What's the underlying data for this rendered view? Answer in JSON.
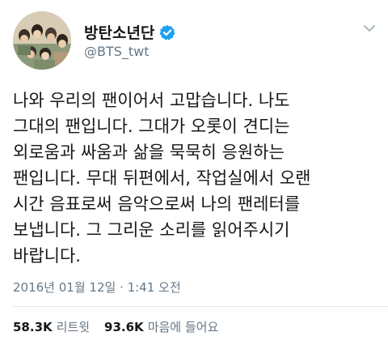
{
  "author": {
    "display_name": "방탄소년단",
    "handle": "@BTS_twt",
    "verified": true
  },
  "tweet": {
    "text": "나와 우리의 팬이어서 고맙습니다. 나도\n그대의 팬입니다. 그대가 오롯이 견디는\n외로움과 싸움과 삶을 묵묵히 응원하는\n팬입니다. 무대 뒤편에서, 작업실에서 오랜\n시간 음표로써 음악으로써 나의 팬레터를\n보냅니다. 그 그리운 소리를 읽어주시기\n바랍니다.",
    "timestamp": "2016년 01월 12일 · 1:41 오전"
  },
  "stats": {
    "retweets_count": "58.3K",
    "retweets_label": "리트윗",
    "likes_count": "93.6K",
    "likes_label": "마음에 들어요"
  },
  "colors": {
    "verified_blue": "#1da1f2",
    "secondary_text": "#657786",
    "primary_text": "#14171a",
    "divider": "#e1e8ed"
  },
  "icons": {
    "verified": "verified-badge-icon",
    "menu": "chevron-down-icon"
  }
}
